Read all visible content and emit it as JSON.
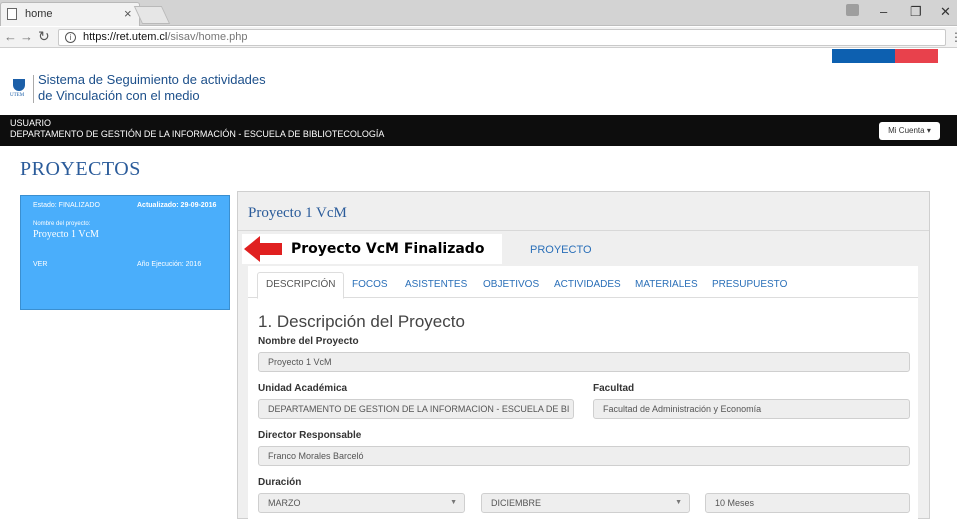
{
  "browser": {
    "tab_title": "home",
    "tab_close": "×",
    "url_domain": "https://ret.utem.cl",
    "url_path": "/sisav/home.php",
    "window_controls": [
      "–",
      "❐",
      "✕"
    ]
  },
  "site": {
    "logo_text": "UTEM",
    "title_line1": "Sistema de Seguimiento de actividades",
    "title_line2": "de Vinculación con el medio",
    "user_label": "USUARIO",
    "department": "DEPARTAMENTO DE GESTIÓN DE LA INFORMACIÓN - ESCUELA DE BIBLIOTECOLOGÍA",
    "account_button": "Mi Cuenta ▾",
    "flag_colors": [
      "#0d60b0",
      "#e8414c"
    ]
  },
  "page": {
    "heading": "PROYECTOS"
  },
  "card": {
    "state": "Estado: FINALIZADO",
    "updated": "Actualizado: 29-09-2016",
    "name_label": "Nombre del proyecto:",
    "name": "Proyecto 1 VcM",
    "ver": "VER",
    "year": "Año Ejecución: 2016",
    "color": "#4aaefb"
  },
  "panel": {
    "title": "Proyecto 1 VcM",
    "project_link": "PROYECTO",
    "annotation": "Proyecto VcM Finalizado",
    "tabs": [
      "DESCRIPCIÓN",
      "FOCOS",
      "ASISTENTES",
      "OBJETIVOS",
      "ACTIVIDADES",
      "MATERIALES",
      "PRESUPUESTO"
    ]
  },
  "form": {
    "section_title": "1. Descripción del Proyecto",
    "name_label": "Nombre del Proyecto",
    "name_value": "Proyecto 1 VcM",
    "unit_label": "Unidad Académica",
    "unit_value": "DEPARTAMENTO DE GESTION DE LA INFORMACION - ESCUELA DE BI",
    "faculty_label": "Facultad",
    "faculty_value": "Facultad de Administración y Economía",
    "director_label": "Director Responsable",
    "director_value": "Franco Morales Barceló",
    "duration_label": "Duración",
    "start_month": "MARZO",
    "end_month": "DICIEMBRE",
    "duration_value": "10 Meses"
  }
}
